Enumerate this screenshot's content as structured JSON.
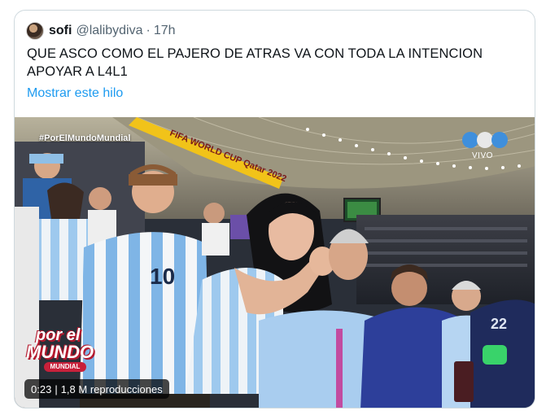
{
  "tweet": {
    "display_name": "sofi",
    "handle": "@lalibydiva",
    "separator": "·",
    "time": "17h",
    "text_line1": "QUE ASCO COMO EL PAJERO DE ATRAS VA CON TODA LA INTENCION",
    "text_line2": "APOYAR A L4L1",
    "thread_link": "Mostrar este hilo"
  },
  "media": {
    "hashtag": "#PorElMundoMundial",
    "banner_text": "FIFA WORLD CUP Qatar 2022",
    "jersey_number": "10",
    "jersey_number_right": "22",
    "live_label": "VIVO",
    "brand_line1": "por el",
    "brand_line2": "MUNDO",
    "brand_line3": "MUNDIAL",
    "video_time": "0:23",
    "view_separator": "|",
    "view_count": "1,8 M reproducciones"
  },
  "colors": {
    "link": "#1d9bf0",
    "secondary_text": "#536471",
    "border": "#cfd9de"
  }
}
